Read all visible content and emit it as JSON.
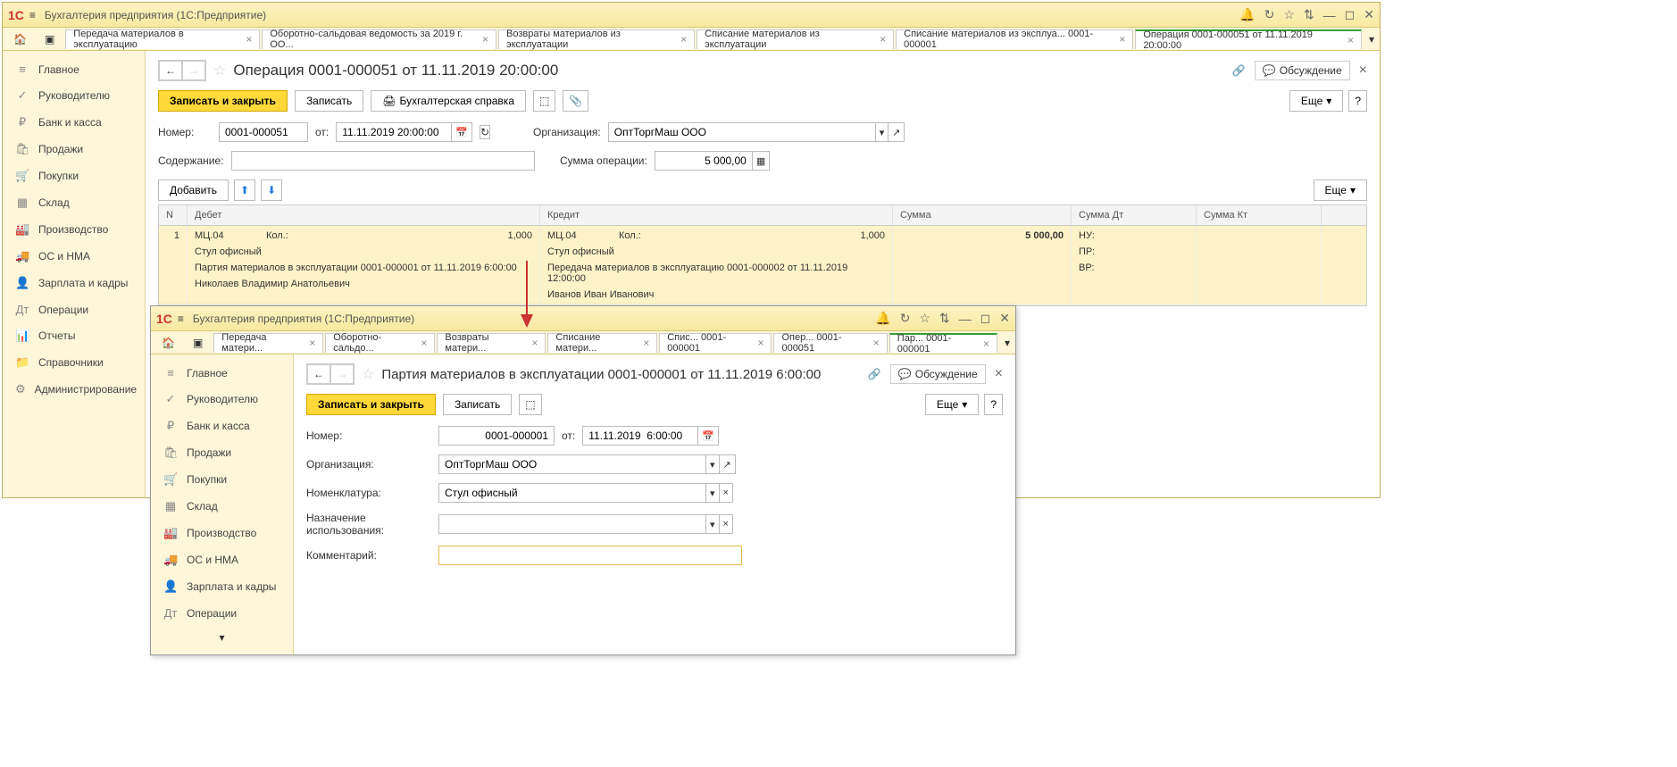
{
  "app": {
    "title_main": "Бухгалтерия предприятия  (1С:Предприятие)",
    "title_sub": "Бухгалтерия предприятия  (1С:Предприятие)"
  },
  "tabs_main": [
    {
      "label": "Передача материалов в эксплуатацию"
    },
    {
      "label": "Оборотно-сальдовая ведомость за 2019 г. ОО..."
    },
    {
      "label": "Возвраты материалов из эксплуатации"
    },
    {
      "label": "Списание материалов из эксплуатации"
    },
    {
      "label": "Списание материалов из эксплуа... 0001-000001"
    },
    {
      "label": "Операция 0001-000051 от 11.11.2019 20:00:00",
      "active": true
    }
  ],
  "tabs_sub": [
    {
      "label": "Передача матери..."
    },
    {
      "label": "Оборотно-сальдо..."
    },
    {
      "label": "Возвраты матери..."
    },
    {
      "label": "Списание матери..."
    },
    {
      "label": "Спис... 0001-000001"
    },
    {
      "label": "Опер... 0001-000051"
    },
    {
      "label": "Пар...   0001-000001",
      "active": true
    }
  ],
  "sidebar": [
    {
      "icon": "≡",
      "label": "Главное"
    },
    {
      "icon": "✓",
      "label": "Руководителю"
    },
    {
      "icon": "₽",
      "label": "Банк и касса"
    },
    {
      "icon": "🛍",
      "label": "Продажи"
    },
    {
      "icon": "🛒",
      "label": "Покупки"
    },
    {
      "icon": "▦",
      "label": "Склад"
    },
    {
      "icon": "🏭",
      "label": "Производство"
    },
    {
      "icon": "🚚",
      "label": "ОС и НМА"
    },
    {
      "icon": "👤",
      "label": "Зарплата и кадры"
    },
    {
      "icon": "Дт",
      "label": "Операции"
    },
    {
      "icon": "📊",
      "label": "Отчеты"
    },
    {
      "icon": "📁",
      "label": "Справочники"
    },
    {
      "icon": "⚙",
      "label": "Администрирование"
    }
  ],
  "sidebar_sub": [
    {
      "icon": "≡",
      "label": "Главное"
    },
    {
      "icon": "✓",
      "label": "Руководителю"
    },
    {
      "icon": "₽",
      "label": "Банк и касса"
    },
    {
      "icon": "🛍",
      "label": "Продажи"
    },
    {
      "icon": "🛒",
      "label": "Покупки"
    },
    {
      "icon": "▦",
      "label": "Склад"
    },
    {
      "icon": "🏭",
      "label": "Производство"
    },
    {
      "icon": "🚚",
      "label": "ОС и НМА"
    },
    {
      "icon": "👤",
      "label": "Зарплата и кадры"
    },
    {
      "icon": "Дт",
      "label": "Операции"
    }
  ],
  "main_doc": {
    "title": "Операция 0001-000051 от 11.11.2019 20:00:00",
    "discuss": "Обсуждение",
    "btn_save_close": "Записать и закрыть",
    "btn_save": "Записать",
    "btn_print": "Бухгалтерская справка",
    "btn_more": "Еще",
    "lbl_number": "Номер:",
    "number": "0001-000051",
    "lbl_from": "от:",
    "date": "11.11.2019 20:00:00",
    "lbl_org": "Организация:",
    "org": "ОптТоргМаш ООО",
    "lbl_content": "Содержание:",
    "content": "",
    "lbl_sum": "Сумма операции:",
    "sum": "5 000,00",
    "btn_add": "Добавить",
    "col_n": "N",
    "col_debit": "Дебет",
    "col_credit": "Кредит",
    "col_sum": "Сумма",
    "col_sumdt": "Сумма Дт",
    "col_sumkt": "Сумма Кт",
    "row": {
      "n": "1",
      "d_acc": "МЦ.04",
      "d_qty_lbl": "Кол.:",
      "d_qty": "1,000",
      "d_item": "Стул офисный",
      "d_batch": "Партия материалов в эксплуатации 0001-000001 от 11.11.2019 6:00:00",
      "d_person": "Николаев Владимир Анатольевич",
      "c_acc": "МЦ.04",
      "c_qty_lbl": "Кол.:",
      "c_qty": "1,000",
      "c_item": "Стул офисный",
      "c_batch": "Передача материалов в эксплуатацию 0001-000002 от 11.11.2019 12:00:00",
      "c_person": "Иванов Иван Иванович",
      "sum": "5 000,00",
      "nu": "НУ:",
      "pr": "ПР:",
      "vr": "ВР:"
    }
  },
  "sub_doc": {
    "title": "Партия материалов в эксплуатации 0001-000001 от 11.11.2019 6:00:00",
    "discuss": "Обсуждение",
    "btn_save_close": "Записать и закрыть",
    "btn_save": "Записать",
    "btn_more": "Еще",
    "lbl_number": "Номер:",
    "number": "0001-000001",
    "lbl_from": "от:",
    "date": "11.11.2019  6:00:00",
    "lbl_org": "Организация:",
    "org": "ОптТоргМаш ООО",
    "lbl_item": "Номенклатура:",
    "item": "Стул офисный",
    "lbl_purpose": "Назначение использования:",
    "purpose": "",
    "lbl_comment": "Комментарий:",
    "comment": ""
  }
}
